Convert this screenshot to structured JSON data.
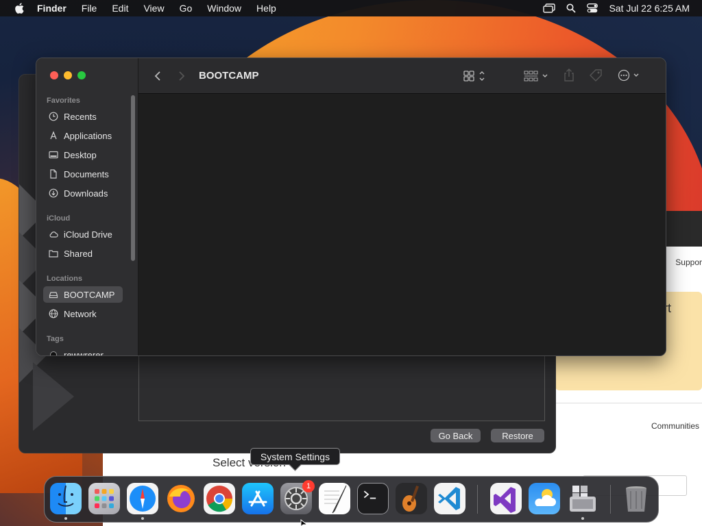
{
  "menubar": {
    "app_name": "Finder",
    "items": [
      "File",
      "Edit",
      "View",
      "Go",
      "Window",
      "Help"
    ],
    "datetime": "Sat Jul 22  6:25 AM"
  },
  "finder": {
    "title": "BOOTCAMP",
    "sidebar": {
      "favorites_header": "Favorites",
      "favorites": [
        {
          "label": "Recents",
          "icon": "clock-icon"
        },
        {
          "label": "Applications",
          "icon": "applications-icon"
        },
        {
          "label": "Desktop",
          "icon": "desktop-icon"
        },
        {
          "label": "Documents",
          "icon": "document-icon"
        },
        {
          "label": "Downloads",
          "icon": "download-icon"
        }
      ],
      "icloud_header": "iCloud",
      "icloud": [
        {
          "label": "iCloud Drive",
          "icon": "cloud-icon"
        },
        {
          "label": "Shared",
          "icon": "shared-folder-icon"
        }
      ],
      "locations_header": "Locations",
      "locations": [
        {
          "label": "BOOTCAMP",
          "icon": "drive-icon",
          "selected": true
        },
        {
          "label": "Network",
          "icon": "globe-icon"
        }
      ],
      "tags_header": "Tags",
      "tags": [
        {
          "label": "rewwrerer",
          "icon": "tag-dot-icon"
        }
      ]
    }
  },
  "background_window": {
    "go_back_label": "Go Back",
    "restore_label": "Restore"
  },
  "webpage": {
    "support_label": "Suppor",
    "promo_text": "ort",
    "communities_label": "Communities",
    "select_text": "Select version"
  },
  "tooltip": {
    "label": "System Settings"
  },
  "dock": {
    "settings_badge": "1",
    "apps": [
      "finder-icon",
      "launchpad-icon",
      "safari-icon",
      "firefox-icon",
      "chrome-icon",
      "app-store-icon",
      "system-settings-icon",
      "textedit-icon",
      "terminal-icon",
      "garageband-icon",
      "vscode-icon",
      "visual-studio-icon",
      "weather-icon",
      "bootcamp-assistant-icon",
      "trash-icon"
    ]
  },
  "colors": {
    "close": "#ff5f57",
    "minimize": "#febc2e",
    "zoom": "#28c840",
    "badge": "#ff3b30"
  }
}
